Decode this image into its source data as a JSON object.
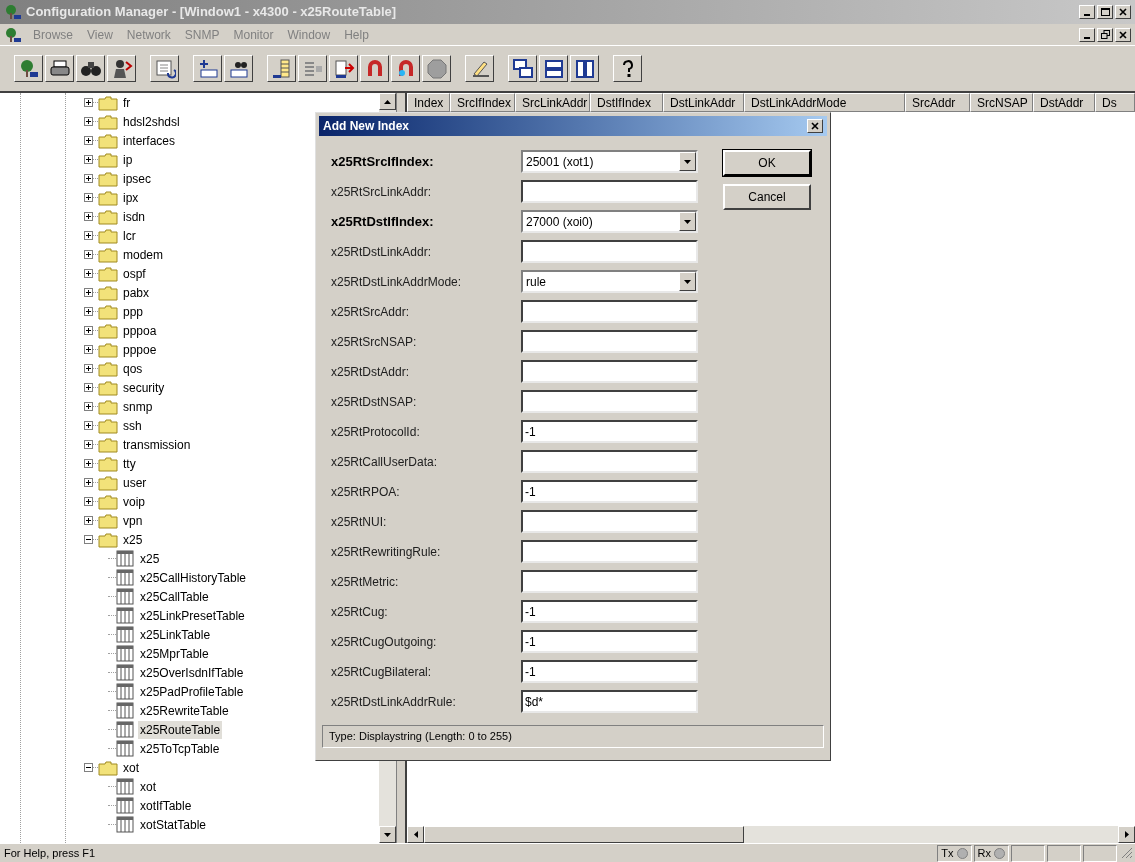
{
  "window": {
    "title": "Configuration Manager - [Window1 - x4300 - x25RouteTable]"
  },
  "menu": [
    "Browse",
    "View",
    "Network",
    "SNMP",
    "Monitor",
    "Window",
    "Help"
  ],
  "tree": [
    {
      "label": "fr",
      "expanded": false,
      "selected": false
    },
    {
      "label": "hdsl2shdsl",
      "expanded": false,
      "selected": false
    },
    {
      "label": "interfaces",
      "expanded": false,
      "selected": false
    },
    {
      "label": "ip",
      "expanded": false,
      "selected": false
    },
    {
      "label": "ipsec",
      "expanded": false,
      "selected": false
    },
    {
      "label": "ipx",
      "expanded": false,
      "selected": false
    },
    {
      "label": "isdn",
      "expanded": false,
      "selected": false
    },
    {
      "label": "lcr",
      "expanded": false,
      "selected": false
    },
    {
      "label": "modem",
      "expanded": false,
      "selected": false
    },
    {
      "label": "ospf",
      "expanded": false,
      "selected": false
    },
    {
      "label": "pabx",
      "expanded": false,
      "selected": false
    },
    {
      "label": "ppp",
      "expanded": false,
      "selected": false
    },
    {
      "label": "pppoa",
      "expanded": false,
      "selected": false
    },
    {
      "label": "pppoe",
      "expanded": false,
      "selected": false
    },
    {
      "label": "qos",
      "expanded": false,
      "selected": false
    },
    {
      "label": "security",
      "expanded": false,
      "selected": false
    },
    {
      "label": "snmp",
      "expanded": false,
      "selected": false
    },
    {
      "label": "ssh",
      "expanded": false,
      "selected": false
    },
    {
      "label": "transmission",
      "expanded": false,
      "selected": false
    },
    {
      "label": "tty",
      "expanded": false,
      "selected": false
    },
    {
      "label": "user",
      "expanded": false,
      "selected": false
    },
    {
      "label": "voip",
      "expanded": false,
      "selected": false
    },
    {
      "label": "vpn",
      "expanded": false,
      "selected": false
    },
    {
      "label": "x25",
      "expanded": true,
      "selected": false,
      "children": [
        {
          "label": "x25",
          "selected": false
        },
        {
          "label": "x25CallHistoryTable",
          "selected": false
        },
        {
          "label": "x25CallTable",
          "selected": false
        },
        {
          "label": "x25LinkPresetTable",
          "selected": false
        },
        {
          "label": "x25LinkTable",
          "selected": false
        },
        {
          "label": "x25MprTable",
          "selected": false
        },
        {
          "label": "x25OverIsdnIfTable",
          "selected": false
        },
        {
          "label": "x25PadProfileTable",
          "selected": false
        },
        {
          "label": "x25RewriteTable",
          "selected": false
        },
        {
          "label": "x25RouteTable",
          "selected": true
        },
        {
          "label": "x25ToTcpTable",
          "selected": false
        }
      ]
    },
    {
      "label": "xot",
      "expanded": true,
      "selected": false,
      "children": [
        {
          "label": "xot",
          "selected": false
        },
        {
          "label": "xotIfTable",
          "selected": false
        },
        {
          "label": "xotStatTable",
          "selected": false
        }
      ]
    }
  ],
  "table": {
    "columns": [
      "Index",
      "SrcIfIndex",
      "SrcLinkAddr",
      "DstIfIndex",
      "DstLinkAddr",
      "DstLinkAddrMode",
      "SrcAddr",
      "SrcNSAP",
      "DstAddr",
      "Ds"
    ]
  },
  "dialog": {
    "title": "Add New Index",
    "fields": [
      {
        "label": "x25RtSrcIfIndex:",
        "kind": "combo",
        "required": true,
        "value": "25001 (xot1)"
      },
      {
        "label": "x25RtSrcLinkAddr:",
        "kind": "text",
        "required": false
      },
      {
        "label": "x25RtDstIfIndex:",
        "kind": "combo",
        "required": true,
        "value": "27000 (xoi0)"
      },
      {
        "label": "x25RtDstLinkAddr:",
        "kind": "text",
        "required": false
      },
      {
        "label": "x25RtDstLinkAddrMode:",
        "kind": "combo",
        "required": false,
        "value": "rule"
      },
      {
        "label": "x25RtSrcAddr:",
        "kind": "text",
        "required": false
      },
      {
        "label": "x25RtSrcNSAP:",
        "kind": "text",
        "required": false
      },
      {
        "label": "x25RtDstAddr:",
        "kind": "text",
        "required": false
      },
      {
        "label": "x25RtDstNSAP:",
        "kind": "text",
        "required": false
      },
      {
        "label": "x25RtProtocolId:",
        "kind": "text",
        "required": false,
        "value": "-1"
      },
      {
        "label": "x25RtCallUserData:",
        "kind": "text",
        "required": false
      },
      {
        "label": "x25RtRPOA:",
        "kind": "text",
        "required": false,
        "value": "-1"
      },
      {
        "label": "x25RtNUI:",
        "kind": "text",
        "required": false
      },
      {
        "label": "x25RtRewritingRule:",
        "kind": "text",
        "required": false
      },
      {
        "label": "x25RtMetric:",
        "kind": "text",
        "required": false
      },
      {
        "label": "x25RtCug:",
        "kind": "text",
        "required": false,
        "value": "-1"
      },
      {
        "label": "x25RtCugOutgoing:",
        "kind": "text",
        "required": false,
        "value": "-1"
      },
      {
        "label": "x25RtCugBilateral:",
        "kind": "text",
        "required": false,
        "value": "-1"
      },
      {
        "label": "x25RtDstLinkAddrRule:",
        "kind": "text",
        "required": false,
        "value": "$d*"
      }
    ],
    "buttons": [
      {
        "label": "OK",
        "default": true
      },
      {
        "label": "Cancel",
        "default": false
      }
    ],
    "hint": "Type: Displaystring (Length: 0 to 255)"
  },
  "status_bar": {
    "text": "For Help, press F1",
    "indicators": [
      "Tx",
      "Rx"
    ]
  }
}
